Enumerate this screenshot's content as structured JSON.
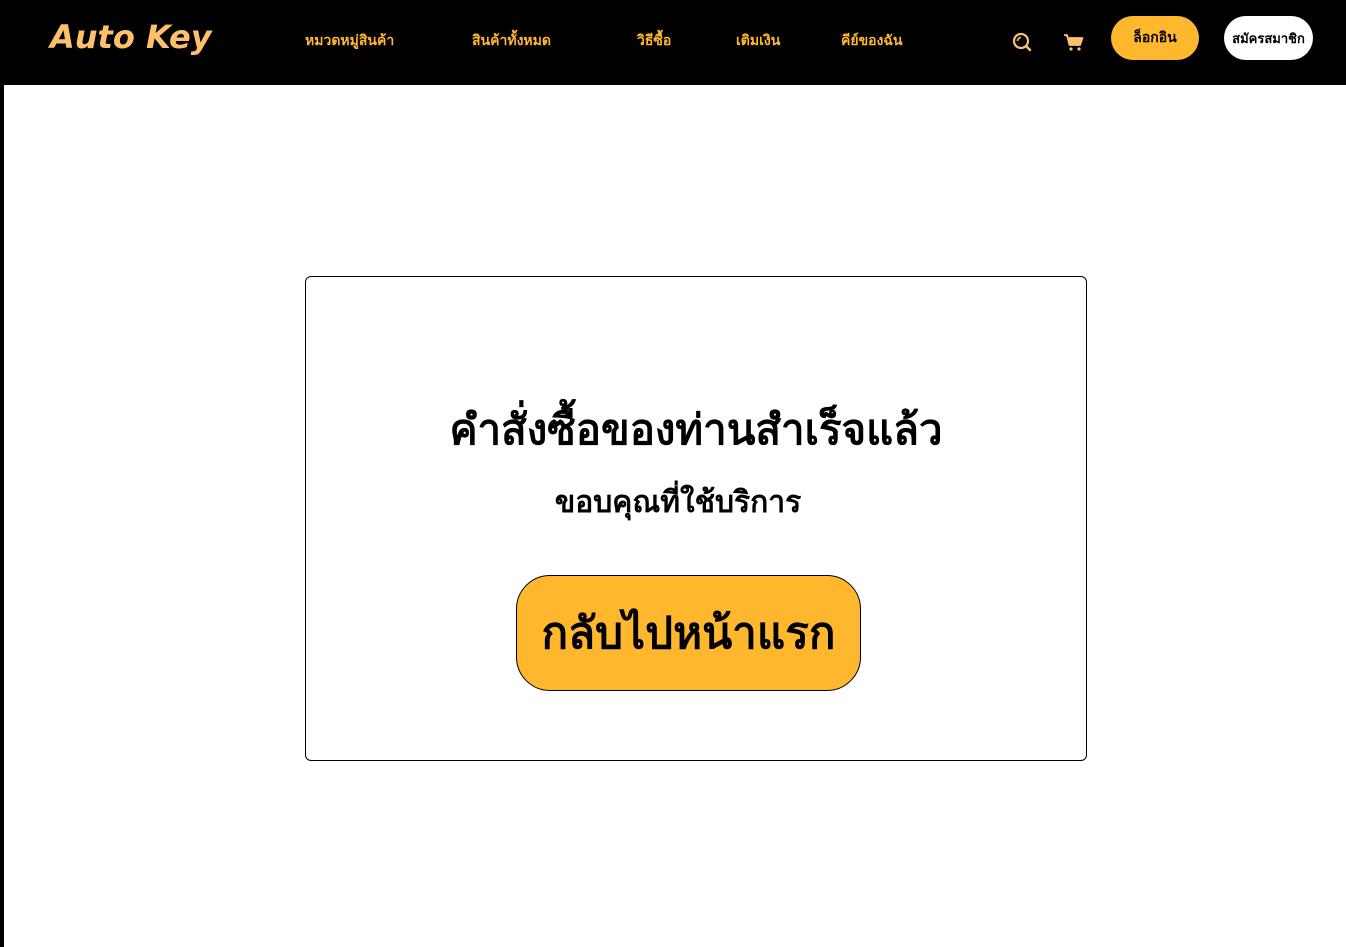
{
  "header": {
    "logo": "Auto Key",
    "nav": [
      {
        "label": "หมวดหมู่สินค้า"
      },
      {
        "label": "สินค้าทั้งหมด"
      },
      {
        "label": "วิธีซื้อ"
      },
      {
        "label": "เติมเงิน"
      },
      {
        "label": "คีย์ของฉัน"
      }
    ],
    "icons": {
      "search": "search-icon",
      "cart": "cart-icon"
    },
    "login_label": "ล็อกอิน",
    "register_label": "สมัครสมาชิก"
  },
  "success": {
    "title": "คำสั่งซื้อของท่านสำเร็จแล้ว",
    "subtitle": "ขอบคุณที่ใช้บริการ",
    "home_button": "กลับไปหน้าแรก"
  },
  "colors": {
    "accent": "#FFB72E",
    "logo": "#FFC06B",
    "nav_bg": "#000000",
    "page_bg": "#FFFFFF"
  }
}
